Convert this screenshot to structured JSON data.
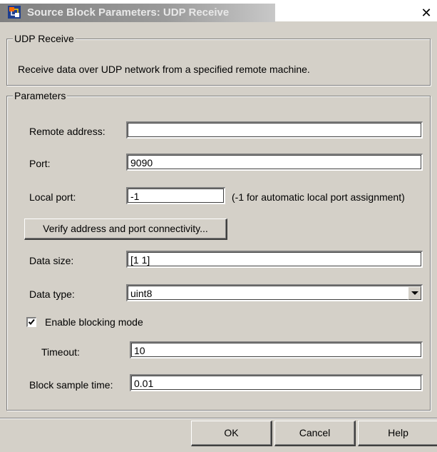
{
  "window": {
    "title": "Source Block Parameters: UDP Receive",
    "close_glyph": "✕"
  },
  "description_group": {
    "legend": "UDP Receive",
    "text": "Receive data over UDP network from a specified remote machine."
  },
  "parameters_group": {
    "legend": "Parameters",
    "remote_address": {
      "label": "Remote address:",
      "value": ""
    },
    "port": {
      "label": "Port:",
      "value": "9090"
    },
    "local_port": {
      "label": "Local port:",
      "value": "-1",
      "hint": "(-1 for automatic local port assignment)"
    },
    "verify_button": "Verify address and port connectivity...",
    "data_size": {
      "label": "Data size:",
      "value": "[1 1]"
    },
    "data_type": {
      "label": "Data type:",
      "selected": "uint8"
    },
    "enable_blocking": {
      "label": "Enable blocking mode",
      "checked": true
    },
    "timeout": {
      "label": "Timeout:",
      "value": "10"
    },
    "block_sample_time": {
      "label": "Block sample time:",
      "value": "0.01"
    }
  },
  "buttons": {
    "ok": "OK",
    "cancel": "Cancel",
    "help": "Help"
  },
  "icons": {
    "app": "simulink-block-icon",
    "close": "close-icon",
    "dropdown": "chevron-down-icon",
    "check": "checkmark-icon"
  }
}
